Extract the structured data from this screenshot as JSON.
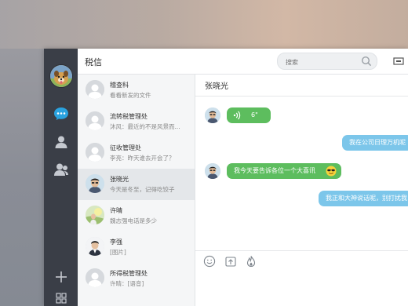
{
  "header": {
    "title": "税信",
    "search_placeholder": "搜索"
  },
  "contacts": [
    {
      "name": "稽查科",
      "preview": "看看新发的文件"
    },
    {
      "name": "流转税管理处",
      "preview": "沐风：最近的不是风景而..."
    },
    {
      "name": "征收管理处",
      "preview": "李亮：昨天谁去开会了？"
    },
    {
      "name": "张晓光",
      "preview": "今天是冬至，记得吃饺子"
    },
    {
      "name": "许晴",
      "preview": "魏志强电话是多少"
    },
    {
      "name": "李强",
      "preview": "[图片]"
    },
    {
      "name": "所得税管理处",
      "preview": "许晴：[语音]"
    }
  ],
  "chat": {
    "title": "张晓光",
    "voice_duration": "6\"",
    "msg_out_1": "我在公司日理万机呢",
    "msg_in_2": "我今天要告诉各位一个大喜讯",
    "msg_out_2": "我正和大神说话呢，别打扰我"
  },
  "colors": {
    "rail": "#3a3e47",
    "green_bubble": "#5dbd5e",
    "blue_bubble": "#7cc6ea",
    "accent": "#2aa3e0"
  },
  "icons": [
    "chat-icon",
    "contact-icon",
    "contacts-group-icon",
    "add-icon",
    "grid-icon",
    "search-icon",
    "emoji-icon",
    "upload-icon",
    "fire-icon"
  ]
}
